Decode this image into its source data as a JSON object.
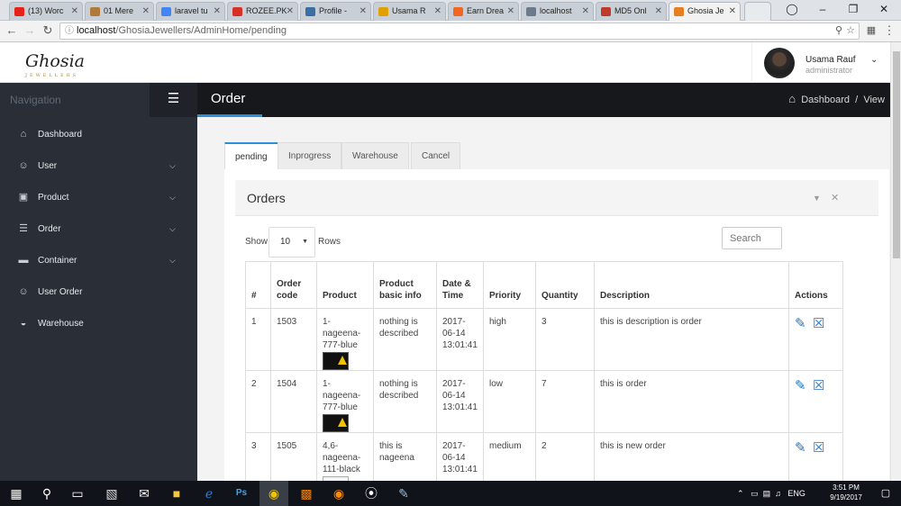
{
  "browser": {
    "tabs": [
      {
        "title": "(13) Worc",
        "color": "#e62117"
      },
      {
        "title": "01 Mere",
        "color": "#b07a3a"
      },
      {
        "title": "laravel tu",
        "color": "#4285f4"
      },
      {
        "title": "ROZEE.PK",
        "color": "#d93025"
      },
      {
        "title": "Profile -",
        "color": "#3a6ea5"
      },
      {
        "title": "Usama R",
        "color": "#e0a100"
      },
      {
        "title": "Earn Drea",
        "color": "#f26522"
      },
      {
        "title": "localhost",
        "color": "#6c7a89"
      },
      {
        "title": "MD5 Onl",
        "color": "#c0392b"
      },
      {
        "title": "Ghosia Je",
        "color": "#e67e22"
      }
    ],
    "url_host": "localhost",
    "url_path": "/GhosiaJewellers/AdminHome/pending"
  },
  "header": {
    "logo": "Ghosia",
    "logo_sub": "JEWELLERS",
    "user_name": "Usama Rauf",
    "user_role": "administrator"
  },
  "sidebar": {
    "heading": "Navigation",
    "items": [
      {
        "label": "Dashboard",
        "icon": "dashboard-icon",
        "glyph": "⌂",
        "expand": false
      },
      {
        "label": "User",
        "icon": "user-icon",
        "glyph": "☺",
        "expand": true
      },
      {
        "label": "Product",
        "icon": "product-icon",
        "glyph": "▣",
        "expand": true
      },
      {
        "label": "Order",
        "icon": "cart-icon",
        "glyph": "☰",
        "expand": true
      },
      {
        "label": "Container",
        "icon": "truck-icon",
        "glyph": "▬",
        "expand": true
      },
      {
        "label": "User Order",
        "icon": "user-icon",
        "glyph": "☺",
        "expand": false
      },
      {
        "label": "Warehouse",
        "icon": "basket-icon",
        "glyph": "◒",
        "expand": false
      }
    ]
  },
  "page": {
    "title": "Order",
    "breadcrumb_dashboard": "Dashboard",
    "breadcrumb_sep": "/",
    "breadcrumb_view": "View"
  },
  "tabs": [
    "pending",
    "Inprogress",
    "Warehouse",
    "Cancel"
  ],
  "panel": {
    "title": "Orders",
    "show_label": "Show",
    "rows_value": "10",
    "rows_label": "Rows",
    "search_placeholder": "Search"
  },
  "table": {
    "headers": [
      "#",
      "Order code",
      "Product",
      "Product basic info",
      "Date & Time",
      "Priority",
      "Quantity",
      "Description",
      "Actions"
    ],
    "rows": [
      {
        "num": "1",
        "code": "1503",
        "product": "1-nageena-777-blue",
        "info": "nothing is described",
        "datetime": "2017-06-14 13:01:41",
        "priority": "high",
        "quantity": "3",
        "description": "this is description is order",
        "thumb": "dark"
      },
      {
        "num": "2",
        "code": "1504",
        "product": "1-nageena-777-blue",
        "info": "nothing is described",
        "datetime": "2017-06-14 13:01:41",
        "priority": "low",
        "quantity": "7",
        "description": "this is order",
        "thumb": "dark"
      },
      {
        "num": "3",
        "code": "1505",
        "product": "4,6-nageena-111-black",
        "info": "this is nageena",
        "datetime": "2017-06-14 13:01:41",
        "priority": "medium",
        "quantity": "2",
        "description": "this is new order",
        "thumb": "light"
      }
    ]
  },
  "taskbar": {
    "lang": "ENG",
    "time": "3:51 PM",
    "date": "9/19/2017"
  }
}
